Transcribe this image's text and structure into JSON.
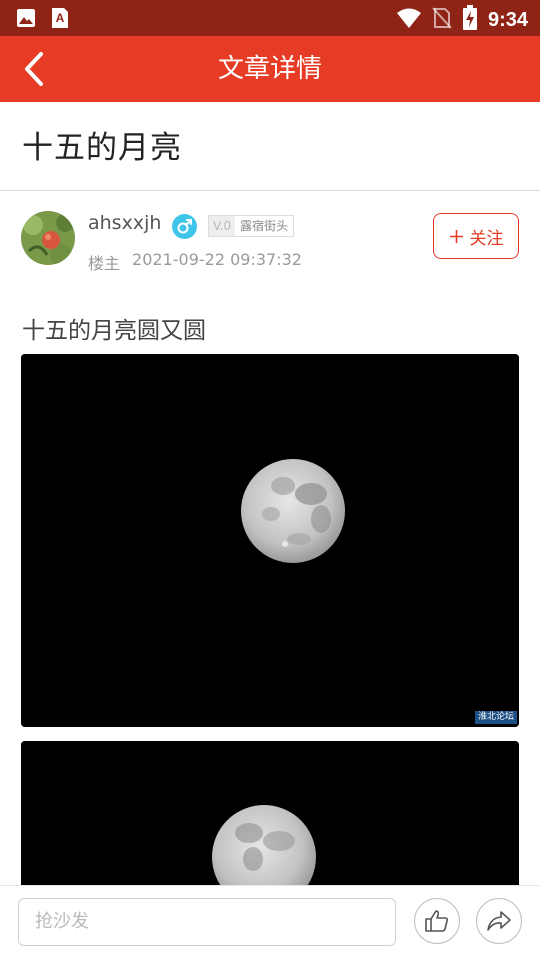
{
  "status_bar": {
    "time": "9:34",
    "icons": [
      "gallery-icon",
      "app-a-icon",
      "wifi-icon",
      "no-sim-icon",
      "battery-charging-icon"
    ]
  },
  "header": {
    "title": "文章详情",
    "back_icon": "chevron-left-icon",
    "bg_color": "#e63b25"
  },
  "article": {
    "title": "十五的月亮",
    "author": {
      "name": "ahsxxjh",
      "gender_icon": "male-icon",
      "level": "V.0",
      "level_name": "露宿街头",
      "role": "楼主",
      "timestamp": "2021-09-22 09:37:32"
    },
    "follow_label": "关注",
    "follow_icon": "plus-icon",
    "body_text": "十五的月亮圆又圆",
    "images": [
      {
        "subject": "full moon",
        "watermark": "淮北论坛"
      },
      {
        "subject": "full moon"
      }
    ]
  },
  "bottom_bar": {
    "comment_placeholder": "抢沙发",
    "like_icon": "thumbs-up-icon",
    "share_icon": "share-arrow-icon"
  }
}
